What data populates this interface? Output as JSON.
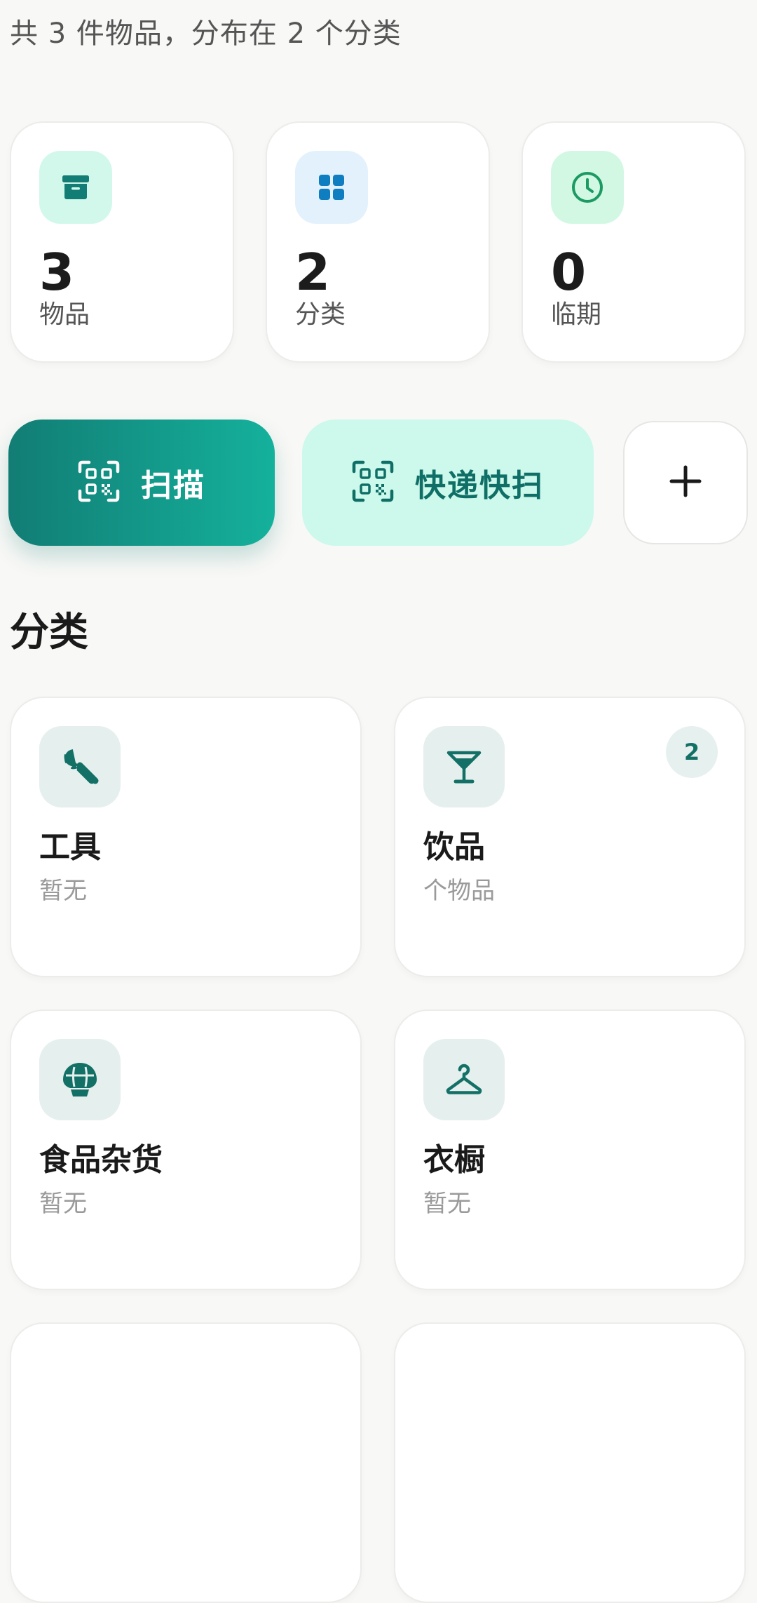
{
  "summary": "共 3 件物品，分布在 2 个分类",
  "stats": [
    {
      "value": "3",
      "label": "物品",
      "icon": "archive-box-icon",
      "color": "#127d74",
      "bg": "#d2f8ec"
    },
    {
      "value": "2",
      "label": "分类",
      "icon": "grid-icon",
      "color": "#0f7ec0",
      "bg": "#e3f1fc"
    },
    {
      "value": "0",
      "label": "临期",
      "icon": "clock-icon",
      "color": "#1c9a63",
      "bg": "#d2f8e4"
    }
  ],
  "actions": {
    "scan_label": "扫描",
    "express_label": "快递快扫",
    "add_icon": "plus-icon"
  },
  "section_title": "分类",
  "categories": [
    {
      "name": "工具",
      "sub": "暂无",
      "icon": "wrench-icon",
      "badge": ""
    },
    {
      "name": "饮品",
      "sub": "个物品",
      "icon": "cocktail-glass-icon",
      "badge": "2"
    },
    {
      "name": "食品杂货",
      "sub": "暂无",
      "icon": "groceries-icon",
      "badge": ""
    },
    {
      "name": "衣橱",
      "sub": "暂无",
      "icon": "hanger-icon",
      "badge": ""
    }
  ],
  "colors": {
    "accent": "#127d74",
    "accent_light": "#cdf8ec",
    "background": "#f8f8f6"
  }
}
